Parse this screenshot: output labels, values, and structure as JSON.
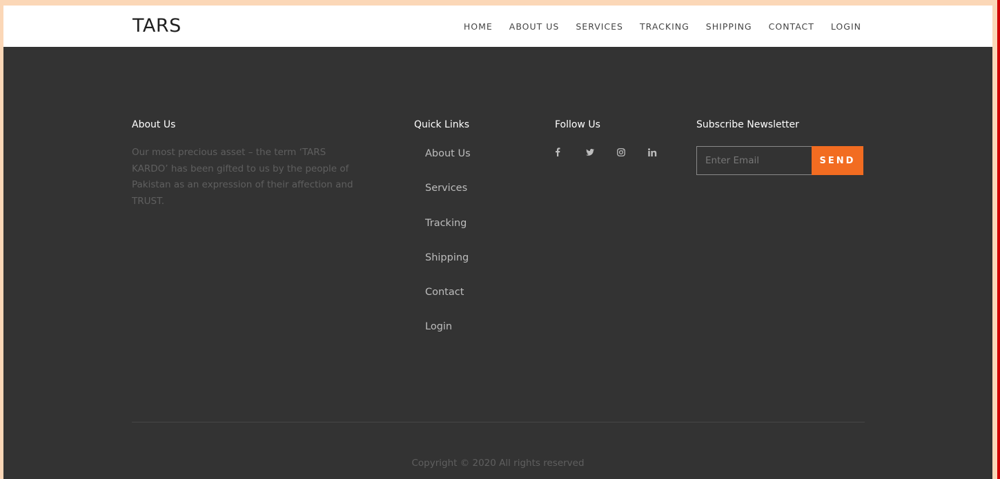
{
  "header": {
    "logo": "TARS",
    "nav": [
      "HOME",
      "ABOUT US",
      "SERVICES",
      "TRACKING",
      "SHIPPING",
      "CONTACT",
      "LOGIN"
    ]
  },
  "footer": {
    "about": {
      "title": "About Us",
      "text": "Our most precious asset – the term ‘TARS KARDO’ has been gifted to us by the people of Pakistan as an expression of their affection and TRUST."
    },
    "quick_links": {
      "title": "Quick Links",
      "items": [
        "About Us",
        "Services",
        "Tracking",
        "Shipping",
        "Contact",
        "Login"
      ]
    },
    "follow": {
      "title": "Follow Us",
      "icons": [
        "facebook-icon",
        "twitter-icon",
        "instagram-icon",
        "linkedin-icon"
      ]
    },
    "newsletter": {
      "title": "Subscribe Newsletter",
      "placeholder": "Enter Email",
      "button": "SEND"
    },
    "copyright": "Copyright © 2020 All rights reserved"
  },
  "colors": {
    "accent": "#f26c21",
    "footer_bg": "#333333",
    "page_bg": "#fbd7b7"
  }
}
